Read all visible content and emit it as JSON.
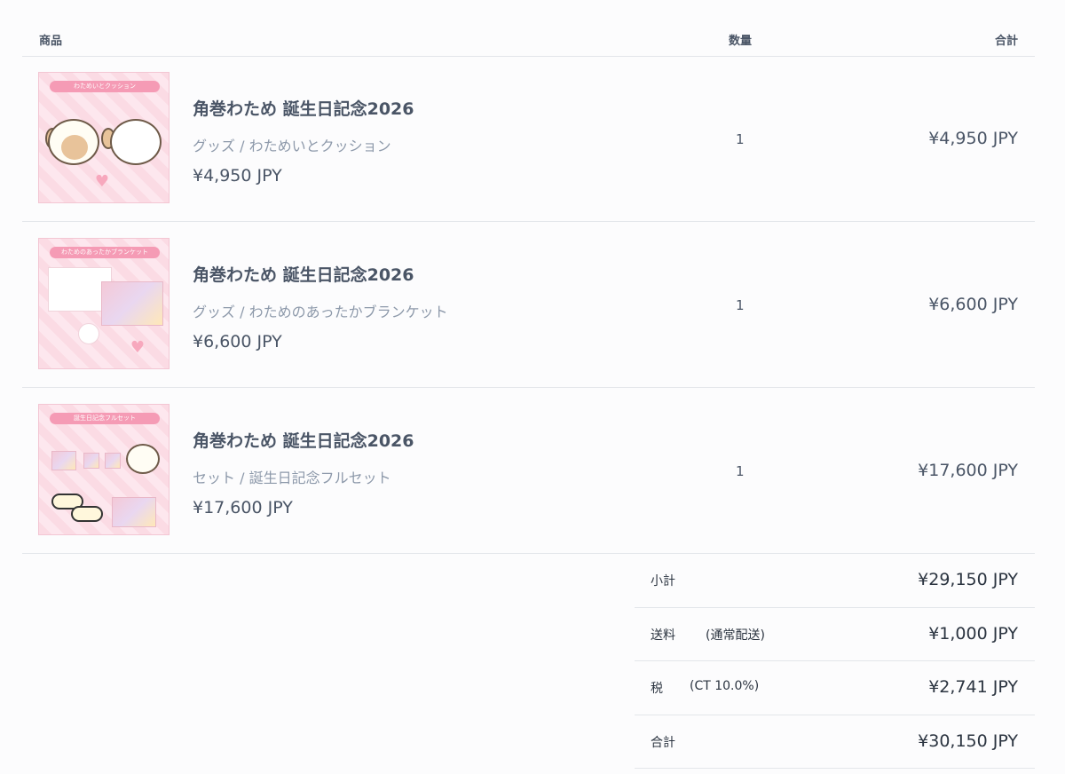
{
  "table": {
    "header_product": "商品",
    "header_quantity": "数量",
    "header_total": "合計"
  },
  "items": [
    {
      "thumb_banner": "わためいとクッション",
      "title": "角巻わため 誕生日記念2026",
      "category": "グッズ / わためいとクッション",
      "price": "¥4,950 JPY",
      "quantity": "1",
      "total": "¥4,950 JPY"
    },
    {
      "thumb_banner": "わためのあったかブランケット",
      "title": "角巻わため 誕生日記念2026",
      "category": "グッズ / わためのあったかブランケット",
      "price": "¥6,600 JPY",
      "quantity": "1",
      "total": "¥6,600 JPY"
    },
    {
      "thumb_banner": "誕生日記念フルセット",
      "title": "角巻わため 誕生日記念2026",
      "category": "セット / 誕生日記念フルセット",
      "price": "¥17,600 JPY",
      "quantity": "1",
      "total": "¥17,600 JPY"
    }
  ],
  "summary": {
    "subtotal_label": "小計",
    "subtotal_value": "¥29,150 JPY",
    "shipping_label": "送料",
    "shipping_note": "(通常配送)",
    "shipping_value": "¥1,000 JPY",
    "tax_label": "税",
    "tax_note": "(CT 10.0%)",
    "tax_value": "¥2,741 JPY",
    "total_label": "合計",
    "total_value": "¥30,150 JPY"
  },
  "colors": {
    "text": "#4a5566",
    "muted": "#8d99aa",
    "divider": "#e3e6ea",
    "thumb_pink": "#fbdbe4"
  }
}
